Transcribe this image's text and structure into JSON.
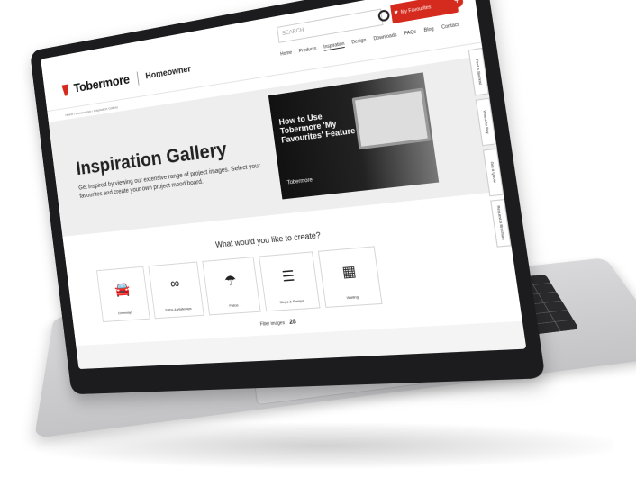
{
  "site": {
    "brand": "Tobermore",
    "section": "Homeowner",
    "search_placeholder": "SEARCH",
    "favourites_label": "My Favourites",
    "nav": [
      "Home",
      "Products",
      "Inspiration",
      "Design",
      "Downloads",
      "FAQs",
      "Blog",
      "Contact"
    ],
    "breadcrumb": "Home / Homeowner / Inspiration Gallery"
  },
  "hero": {
    "title": "Inspiration Gallery",
    "text": "Get inspired by viewing our extensive range of project images. Select your favourites and create your own project mood board."
  },
  "video": {
    "title": "How to Use Tobermore 'My Favourites' Feature ?",
    "brand": "Tobermore"
  },
  "create": {
    "title": "What would you like to create?",
    "categories": [
      {
        "label": "Driveways",
        "icon": "car-icon"
      },
      {
        "label": "Paths & Walkways",
        "icon": "footprints-icon"
      },
      {
        "label": "Patios",
        "icon": "patio-icon"
      },
      {
        "label": "Steps & Ramps",
        "icon": "steps-icon"
      },
      {
        "label": "Walling",
        "icon": "wall-icon"
      }
    ]
  },
  "filter": {
    "label": "Filter images",
    "value": "28"
  },
  "side_tabs": [
    "Find a Stockist",
    "Where to Buy",
    "Get a Quote",
    "Request a Brochure"
  ],
  "colors": {
    "brand_red": "#d52b1e",
    "laptop_body": "#1c1c1e",
    "keyboard": "#2a2a2c"
  }
}
